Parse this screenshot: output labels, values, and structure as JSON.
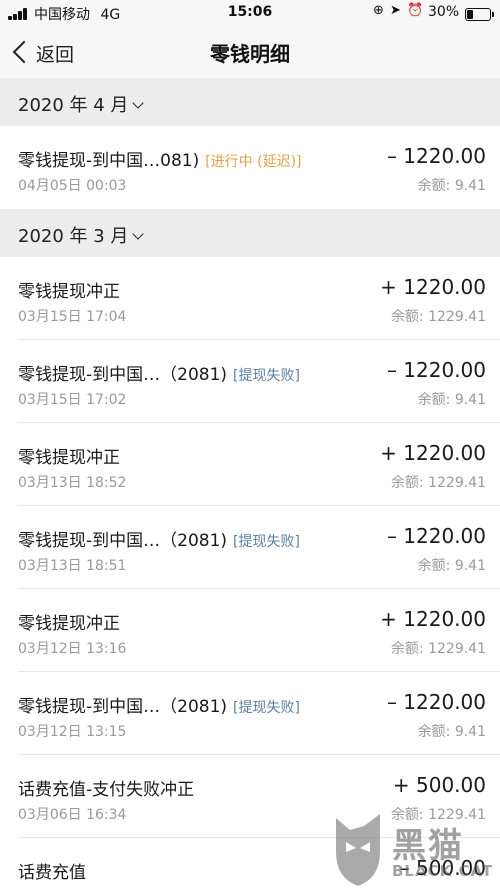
{
  "status_bar": {
    "carrier": "中国移动",
    "network": "4G",
    "time": "15:06",
    "battery": "30%",
    "battery_level": 0.3
  },
  "nav": {
    "back_label": "返回",
    "title": "零钱明细"
  },
  "sections": [
    {
      "month": "2020 年 4 月",
      "records": [
        {
          "title": "零钱提现-到中国…081)",
          "tag": "[进行中 (延迟)]",
          "time": "04月05日 00:03",
          "amount": "– 1220.00",
          "balance": "余额: 9.41"
        }
      ]
    },
    {
      "month": "2020 年 3 月",
      "records": [
        {
          "title": "零钱提现冲正",
          "tag": "",
          "time": "03月15日 17:04",
          "amount": "+ 1220.00",
          "balance": "余额: 1229.41"
        },
        {
          "title": "零钱提现-到中国…（2081)",
          "tag": "[提现失败]",
          "time": "03月15日 17:02",
          "amount": "– 1220.00",
          "balance": "余额: 9.41"
        },
        {
          "title": "零钱提现冲正",
          "tag": "",
          "time": "03月13日 18:52",
          "amount": "+ 1220.00",
          "balance": "余额: 1229.41"
        },
        {
          "title": "零钱提现-到中国…（2081)",
          "tag": "[提现失败]",
          "time": "03月13日 18:51",
          "amount": "– 1220.00",
          "balance": "余额: 9.41"
        },
        {
          "title": "零钱提现冲正",
          "tag": "",
          "time": "03月12日 13:16",
          "amount": "+ 1220.00",
          "balance": "余额: 1229.41"
        },
        {
          "title": "零钱提现-到中国…（2081)",
          "tag": "[提现失败]",
          "time": "03月12日 13:15",
          "amount": "– 1220.00",
          "balance": "余额: 9.41"
        },
        {
          "title": "话费充值-支付失败冲正",
          "tag": "",
          "time": "03月06日 16:34",
          "amount": "+ 500.00",
          "balance": "余额: 1229.41"
        },
        {
          "title": "话费充值",
          "tag": "",
          "time": "",
          "amount": "– 500.00",
          "balance": ""
        }
      ]
    }
  ],
  "watermark": {
    "cn": "黑猫",
    "en": "BLACK CAT"
  },
  "colors": {
    "tag_in_progress": "#e8a33d",
    "tag_failed": "#5b80a8",
    "section_bg": "#ededed"
  }
}
